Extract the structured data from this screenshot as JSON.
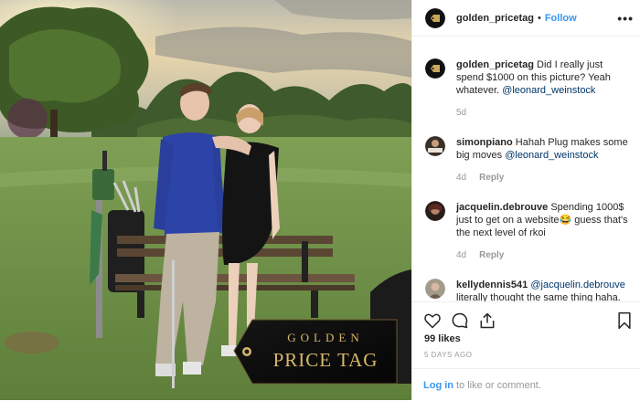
{
  "header": {
    "username": "golden_pricetag",
    "separator": "•",
    "follow_label": "Follow",
    "more_label": "•••"
  },
  "photo": {
    "tag_line1": "GOLDEN",
    "tag_line2": "PRICE TAG"
  },
  "comments": [
    {
      "username": "golden_pricetag",
      "text": "Did I really just spend $1000 on this picture? Yeah whatever.",
      "mention": "@leonard_weinstock",
      "time": "5d",
      "reply": ""
    },
    {
      "username": "simonpiano",
      "text": "Hahah Plug makes some big moves",
      "mention": "@leonard_weinstock",
      "time": "4d",
      "reply": "Reply"
    },
    {
      "username": "jacquelin.debrouve",
      "text": "Spending 1000$ just to get on a website😂 guess that's the next level of rkoi",
      "mention": "",
      "time": "4d",
      "reply": "Reply"
    },
    {
      "username": "kellydennis541",
      "mention": "@jacquelin.debrouve",
      "text": "literally thought the same thing haha. Once this thing goes mainstream and",
      "time": "",
      "reply": ""
    }
  ],
  "actions": {
    "likes": "99 likes",
    "age": "5 DAYS AGO",
    "login_link": "Log in",
    "login_text": "to like or comment."
  },
  "icons": [
    "heart-icon",
    "comment-icon",
    "share-icon",
    "bookmark-icon",
    "more-icon"
  ],
  "colors": {
    "accent": "#3897f0",
    "mention": "#003569",
    "meta": "#999999",
    "tag_gold": "#d7b86a"
  }
}
